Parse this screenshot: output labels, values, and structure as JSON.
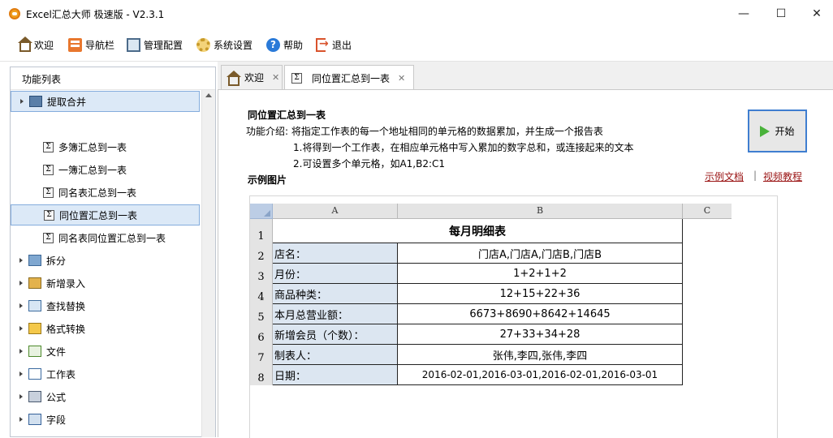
{
  "window": {
    "title": "Excel汇总大师 极速版 - V2.3.1",
    "minimize": "—",
    "maximize": "☐",
    "close": "✕"
  },
  "toolbar": {
    "items": [
      {
        "label": "欢迎",
        "icon": "home-icon"
      },
      {
        "label": "导航栏",
        "icon": "navigation-icon"
      },
      {
        "label": "管理配置",
        "icon": "config-icon"
      },
      {
        "label": "系统设置",
        "icon": "gear-icon"
      },
      {
        "label": "帮助",
        "icon": "help-icon"
      },
      {
        "label": "退出",
        "icon": "exit-icon"
      }
    ]
  },
  "sidebar": {
    "header": "功能列表",
    "groups": [
      {
        "label": "提取合并",
        "expanded": true
      },
      {
        "label": "拆分"
      },
      {
        "label": "新增录入"
      },
      {
        "label": "查找替换"
      },
      {
        "label": "格式转换"
      },
      {
        "label": "文件"
      },
      {
        "label": "工作表"
      },
      {
        "label": "公式"
      },
      {
        "label": "字段"
      }
    ],
    "children": [
      {
        "label": "多簿汇总到一表"
      },
      {
        "label": "一簿汇总到一表"
      },
      {
        "label": "同名表汇总到一表"
      },
      {
        "label": "同位置汇总到一表",
        "selected": true
      },
      {
        "label": "同名表同位置汇总到一表"
      }
    ]
  },
  "tabs": [
    {
      "label": "欢迎",
      "close": "✕",
      "icon": "home-icon"
    },
    {
      "label": "同位置汇总到一表",
      "close": "✕",
      "icon": "sigma-icon",
      "active": true
    }
  ],
  "content": {
    "title": "同位置汇总到一表",
    "description": "功能介绍: 将指定工作表的每一个地址相同的单元格的数据累加，并生成一个报告表",
    "points": [
      "1.将得到一个工作表，在相应单元格中写入累加的数字总和，或连接起来的文本",
      "2.可设置多个单元格，如A1,B2:C1"
    ],
    "example_label": "示例图片",
    "start_button": "开始",
    "links": {
      "doc": "示例文档",
      "separator": "|",
      "video": "视频教程"
    }
  },
  "sample_sheet": {
    "columns": [
      "A",
      "B",
      "C"
    ],
    "row_numbers": [
      "1",
      "2",
      "3",
      "4",
      "5",
      "6",
      "7",
      "8"
    ],
    "title": "每月明细表",
    "rows": [
      {
        "label": "店名：",
        "value": "门店A,门店A,门店B,门店B"
      },
      {
        "label": "月份：",
        "value": "1+2+1+2"
      },
      {
        "label": "商品种类：",
        "value": "12+15+22+36"
      },
      {
        "label": "本月总营业额：",
        "value": "6673+8690+8642+14645"
      },
      {
        "label": "新增会员（个数）：",
        "value": "27+33+34+28"
      },
      {
        "label": "制表人：",
        "value": "张伟,李四,张伟,李四"
      },
      {
        "label": "日期：",
        "value": "2016-02-01,2016-03-01,2016-02-01,2016-03-01"
      }
    ]
  }
}
